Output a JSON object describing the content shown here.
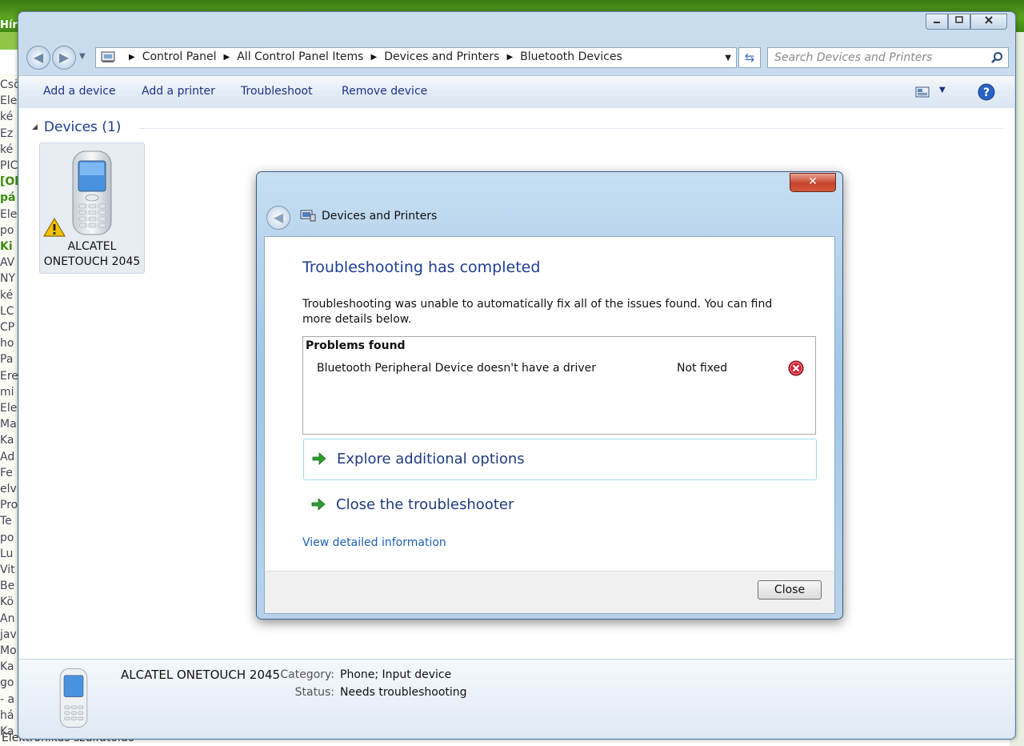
{
  "background_page": {
    "logo_fragment": "Hírek",
    "left_fragments": [
      "Csö",
      "Ele",
      "ké",
      "Ez",
      "ké",
      "PIC",
      "[Ol",
      "pá",
      "Ele",
      "po",
      "Ki",
      "AV",
      "NY",
      "ké",
      "LC",
      "CP",
      "ho",
      "Pa",
      "Ere",
      "mi",
      "Ele",
      "Ma",
      "Ka",
      "Ad",
      "Fe",
      "elv",
      "Pro",
      "Te",
      "po",
      "Lu",
      "Vit",
      "Be",
      "Kö",
      "An",
      "jav",
      "Mo",
      "Ka",
      "go",
      "- a",
      "há",
      "Ka"
    ],
    "bottom_text": "Elektronikus szulfátoldó"
  },
  "window": {
    "address": {
      "crumbs": [
        "Control Panel",
        "All Control Panel Items",
        "Devices and Printers",
        "Bluetooth Devices"
      ]
    },
    "search": {
      "placeholder": "Search Devices and Printers"
    },
    "toolbar": {
      "add_device": "Add a device",
      "add_printer": "Add a printer",
      "troubleshoot": "Troubleshoot",
      "remove_device": "Remove device"
    },
    "group": {
      "header": "Devices (1)"
    },
    "device": {
      "name": "ALCATEL\nONETOUCH 2045"
    },
    "details": {
      "name": "ALCATEL ONETOUCH 2045",
      "category_label": "Category:",
      "category_value": "Phone; Input device",
      "status_label": "Status:",
      "status_value": "Needs troubleshooting"
    }
  },
  "dialog": {
    "title": "Devices and Printers",
    "close_glyph": "✕",
    "heading": "Troubleshooting has completed",
    "message": "Troubleshooting was unable to automatically fix all of the issues found. You can find more details below.",
    "problems": {
      "header": "Problems found",
      "items": [
        {
          "description": "Bluetooth Peripheral Device doesn't have a driver",
          "status": "Not fixed"
        }
      ]
    },
    "explore_label": "Explore additional options",
    "close_troubleshooter_label": "Close the troubleshooter",
    "view_detailed_label": "View detailed information",
    "close_button": "Close"
  },
  "colors": {
    "heading_blue": "#1e3e92",
    "link_blue": "#1c5fb4",
    "arrow_green": "#2e9d31",
    "error_red": "#cc2233",
    "warning_yellow": "#f2c200"
  }
}
